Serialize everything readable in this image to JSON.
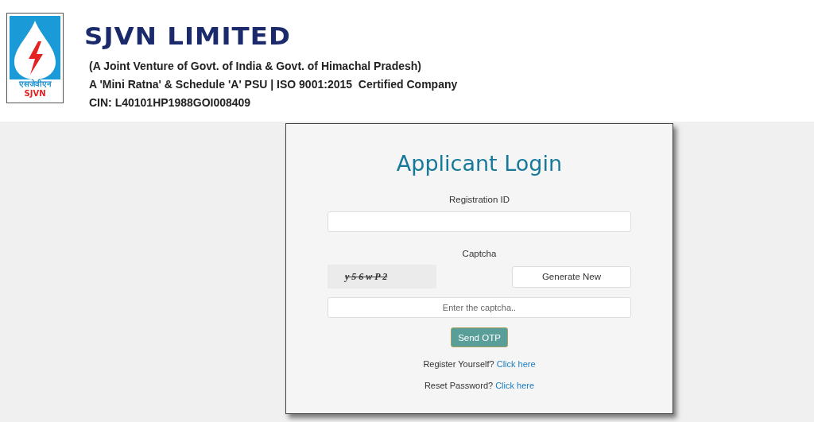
{
  "header": {
    "logo": {
      "hindi": "एसजेवीएन",
      "latin": "SJVN"
    },
    "company": "SJVN LIMITED",
    "lines": [
      "(A Joint Venture of Govt. of India & Govt. of Himachal Pradesh)",
      "A 'Mini Ratna' & Schedule 'A' PSU | ISO 9001:2015  Certified Company",
      "CIN: L40101HP1988GOI008409"
    ]
  },
  "login": {
    "title": "Applicant Login",
    "registration_label": "Registration ID",
    "captcha_label": "Captcha",
    "captcha_text": "y 5 6 w P 2",
    "generate_button": "Generate New",
    "captcha_placeholder": "Enter the captcha..",
    "send_button": "Send OTP",
    "links": [
      {
        "prompt": "Register Yourself?",
        "link": "Click here"
      },
      {
        "prompt": "Reset Password?",
        "link": "Click here"
      }
    ]
  }
}
